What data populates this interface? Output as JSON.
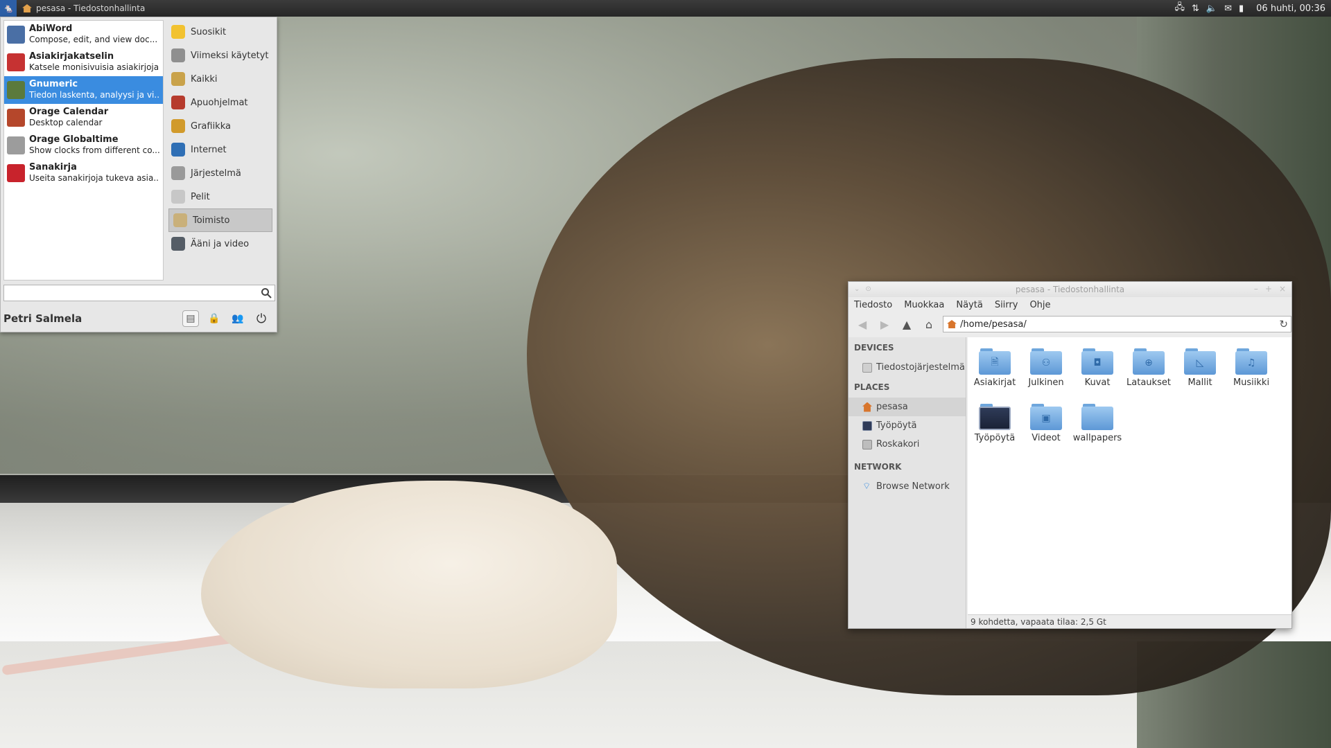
{
  "panel": {
    "window_title": "pesasa - Tiedostonhallinta",
    "clock": "06 huhti, 00:36"
  },
  "whisker": {
    "apps": [
      {
        "name": "AbiWord",
        "desc": "Compose, edit, and view doc...",
        "color": "#4a6fa5"
      },
      {
        "name": "Asiakirjakatselin",
        "desc": "Katsele monisivuisia asiakirjoja",
        "color": "#c63232"
      },
      {
        "name": "Gnumeric",
        "desc": "Tiedon laskenta, analyysi ja vi...",
        "color": "#5b7a3c"
      },
      {
        "name": "Orage Calendar",
        "desc": "Desktop calendar",
        "color": "#b5472b"
      },
      {
        "name": "Orage Globaltime",
        "desc": "Show clocks from different co...",
        "color": "#9c9c9c"
      },
      {
        "name": "Sanakirja",
        "desc": "Useita sanakirjoja tukeva asia...",
        "color": "#c8232c"
      }
    ],
    "categories": [
      {
        "label": "Suosikit",
        "color": "#f2c230"
      },
      {
        "label": "Viimeksi käytetyt",
        "color": "#8f8f8f"
      },
      {
        "label": "Kaikki",
        "color": "#c9a24a"
      },
      {
        "label": "Apuohjelmat",
        "color": "#b63b2d"
      },
      {
        "label": "Grafiikka",
        "color": "#d19a2b"
      },
      {
        "label": "Internet",
        "color": "#2f6fb5"
      },
      {
        "label": "Järjestelmä",
        "color": "#9a9a9a"
      },
      {
        "label": "Pelit",
        "color": "#c7c7c7"
      },
      {
        "label": "Toimisto",
        "color": "#c9b07a"
      },
      {
        "label": "Ääni ja video",
        "color": "#555d66"
      }
    ],
    "search_value": "",
    "user": "Petri Salmela"
  },
  "filemanager": {
    "title": "pesasa - Tiedostonhallinta",
    "menu": [
      "Tiedosto",
      "Muokkaa",
      "Näytä",
      "Siirry",
      "Ohje"
    ],
    "path": "/home/pesasa/",
    "sidebar": {
      "devices_header": "DEVICES",
      "devices": [
        "Tiedostojärjestelmä"
      ],
      "places_header": "PLACES",
      "places": [
        "pesasa",
        "Työpöytä",
        "Roskakori"
      ],
      "network_header": "NETWORK",
      "network": [
        "Browse Network"
      ]
    },
    "items": [
      {
        "label": "Asiakirjat",
        "glyph": "🗎"
      },
      {
        "label": "Julkinen",
        "glyph": "⚇"
      },
      {
        "label": "Kuvat",
        "glyph": "◘"
      },
      {
        "label": "Lataukset",
        "glyph": "⊕"
      },
      {
        "label": "Mallit",
        "glyph": "◺"
      },
      {
        "label": "Musiikki",
        "glyph": "♫"
      },
      {
        "label": "Työpöytä",
        "glyph": ""
      },
      {
        "label": "Videot",
        "glyph": "▣"
      },
      {
        "label": "wallpapers",
        "glyph": ""
      }
    ],
    "status": "9 kohdetta, vapaata tilaa: 2,5 Gt"
  }
}
